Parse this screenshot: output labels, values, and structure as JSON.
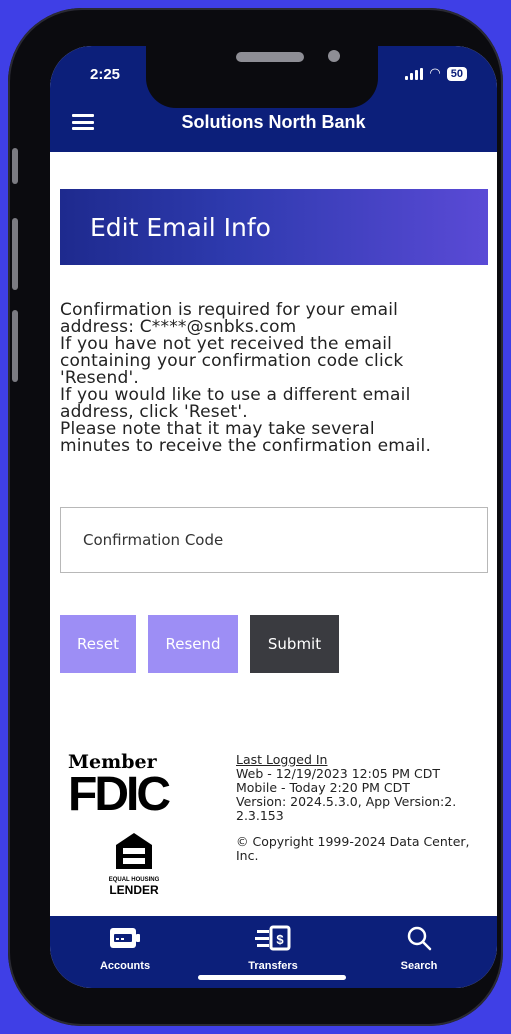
{
  "status_bar": {
    "time": "2:25",
    "battery": "50"
  },
  "header": {
    "title": "Solutions North Bank"
  },
  "banner": {
    "title": "Edit Email Info"
  },
  "message": {
    "lines": [
      "Confirmation is required for your email",
      "address: C****@snbks.com",
      "If you have not yet received the email",
      "containing your confirmation code click",
      "'Resend'.",
      "If you would like to use a different email",
      "address, click 'Reset'.",
      "Please note that it may take several",
      "minutes to receive the confirmation email."
    ]
  },
  "form": {
    "code_placeholder": "Confirmation Code",
    "reset_label": "Reset",
    "resend_label": "Resend",
    "submit_label": "Submit"
  },
  "footer": {
    "member": "Member",
    "fdic": "FDIC",
    "ehl_small": "EQUAL HOUSING",
    "ehl_big": "LENDER",
    "last_logged_label": "Last Logged In",
    "web": "Web - 12/19/2023 12:05 PM CDT",
    "mobile": "Mobile - Today 2:20 PM CDT",
    "version": "Version: 2024.5.3.0, App Version:2.",
    "version_cont": "2.3.153",
    "copyright": "© Copyright 1999-2024 Data Center,",
    "copyright_cont": "Inc."
  },
  "tabs": [
    {
      "label": "Accounts",
      "icon": "wallet-icon"
    },
    {
      "label": "Transfers",
      "icon": "transfer-icon"
    },
    {
      "label": "Search",
      "icon": "search-icon"
    }
  ],
  "colors": {
    "navy": "#0c1f7a",
    "lavender": "#9d8ef5",
    "dark_button": "#3a3b40",
    "background": "#3f3fe6"
  }
}
